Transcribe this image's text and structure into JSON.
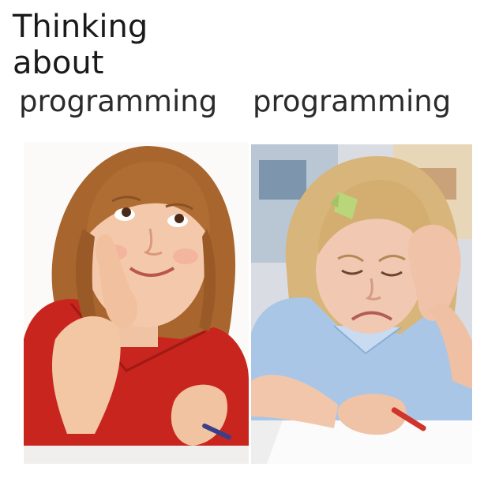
{
  "caption": {
    "left_line1": "Thinking",
    "left_line2": "about",
    "left_line3": "programming",
    "right": "programming"
  },
  "photos": {
    "left": "smiling-girl-daydreaming",
    "right": "frustrated-girl-writing"
  }
}
